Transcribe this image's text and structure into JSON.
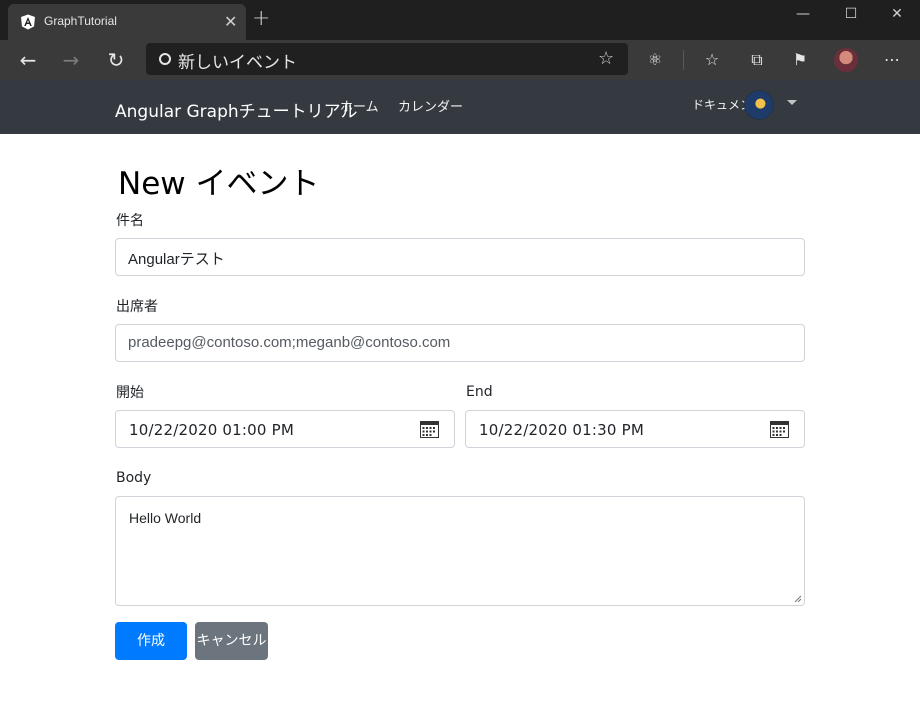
{
  "browser": {
    "tab_title": "GraphTutorial",
    "tab_close": "✕",
    "new_tab": "+",
    "window_controls": {
      "minimize": "—",
      "maximize": "☐",
      "close": "✕"
    },
    "address_text": "新しいイベント",
    "icons": [
      "back-icon",
      "forward-icon",
      "refresh-icon",
      "favorite-star-icon",
      "extension-icon",
      "favorites-icon",
      "collections-icon",
      "feedback-icon",
      "profile-avatar",
      "more-icon"
    ]
  },
  "navbar": {
    "brand": "Angular Graphチュートリアル",
    "links": [
      "ホーム",
      "カレンダー"
    ],
    "user_label": "ドキュメント"
  },
  "form": {
    "title": "New イベント",
    "subject": {
      "label": "件名",
      "value": "Angularテスト"
    },
    "attendees": {
      "label": "出席者",
      "value": "pradeepg@contoso.com;meganb@contoso.com"
    },
    "start": {
      "label": "開始",
      "value": "10/22/2020 01:00 PM"
    },
    "end": {
      "label": "End",
      "value": "10/22/2020 01:30 PM"
    },
    "body": {
      "label": "Body",
      "value": "Hello World"
    },
    "buttons": {
      "create": "作成",
      "cancel": "キャンセル"
    }
  },
  "colors": {
    "navbar_bg": "#343a40",
    "primary": "#007bff",
    "secondary": "#6c757d",
    "border": "#ced4da"
  }
}
